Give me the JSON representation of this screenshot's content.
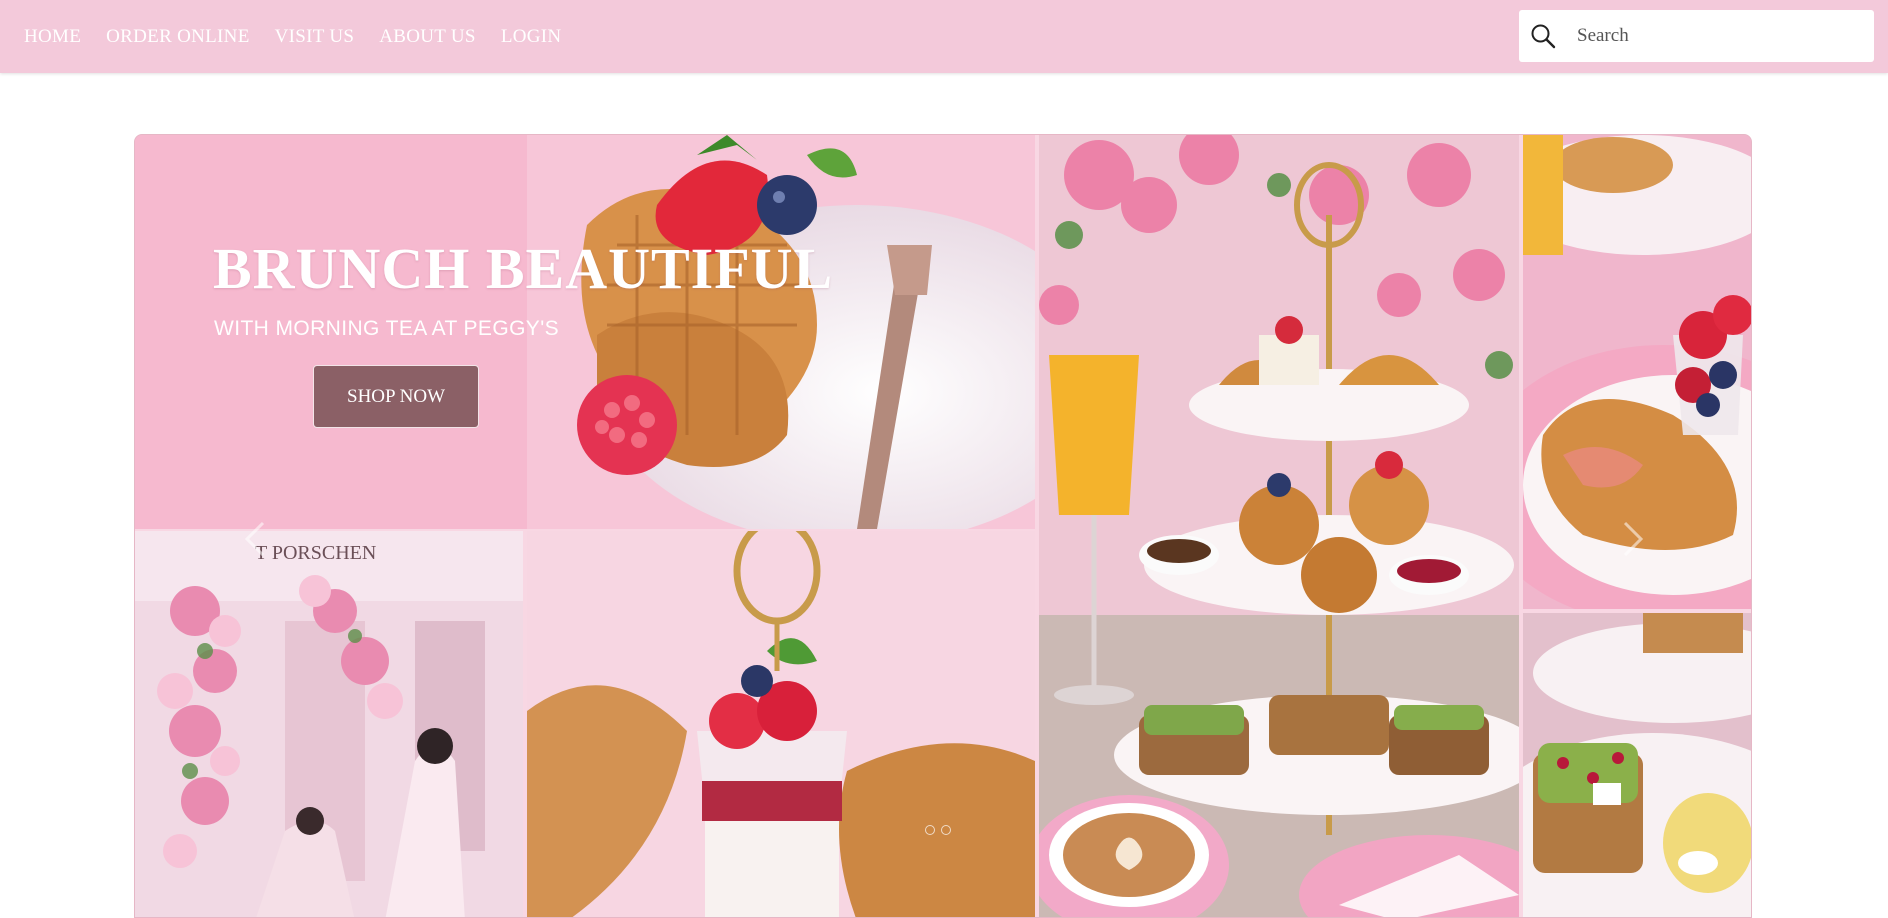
{
  "nav": {
    "items": [
      {
        "label": "HOME"
      },
      {
        "label": "ORDER ONLINE"
      },
      {
        "label": "VISIT US"
      },
      {
        "label": "ABOUT US"
      },
      {
        "label": "LOGIN"
      }
    ]
  },
  "search": {
    "placeholder": "Search",
    "icon": "search-icon"
  },
  "hero": {
    "title": "BRUNCH BEAUTIFUL",
    "subtitle": "WITH MORNING TEA AT PEGGY'S",
    "button_label": "SHOP NOW",
    "background_color": "#f5b8cf",
    "button_color": "#8b6066"
  },
  "colors": {
    "navbar": "#f3c9da",
    "nav_text": "#ffffff"
  }
}
